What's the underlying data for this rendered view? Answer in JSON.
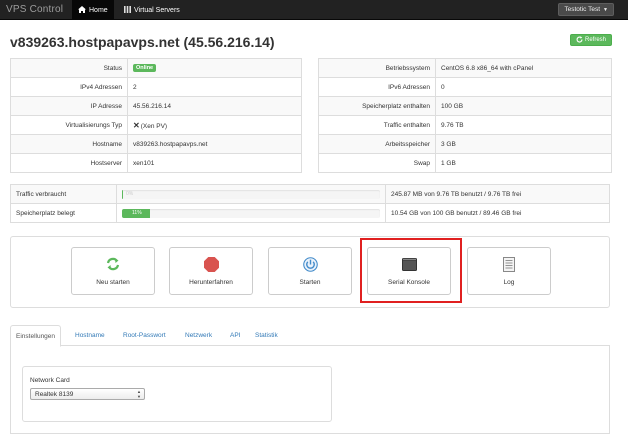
{
  "navbar": {
    "brand": "VPS Control",
    "home_label": "Home",
    "home_icon": "home-icon",
    "servers_label": "Virtual Servers",
    "servers_icon": "list-icon",
    "user_label": "Testotic Test"
  },
  "header": {
    "title": "v839263.hostpapavps.net (45.56.216.14)",
    "refresh_label": "Refresh",
    "refresh_icon": "refresh-icon"
  },
  "info_left": [
    {
      "label": "Status",
      "value": "Online"
    },
    {
      "label": "IPv4 Adressen",
      "value": "2"
    },
    {
      "label": "IP Adresse",
      "value": "45.56.216.14"
    },
    {
      "label": "Virtualisierungs Typ",
      "value": "(Xen PV)"
    },
    {
      "label": "Hostname",
      "value": "v839263.hostpapavps.net"
    },
    {
      "label": "Hostserver",
      "value": "xen101"
    }
  ],
  "info_right": [
    {
      "label": "Betriebssystem",
      "value": "CentOS 6.8 x86_64 with cPanel"
    },
    {
      "label": "IPv6 Adressen",
      "value": "0"
    },
    {
      "label": "Speicherplatz enthalten",
      "value": "100 GB"
    },
    {
      "label": "Traffic enthalten",
      "value": "9.76 TB"
    },
    {
      "label": "Arbeitsspeicher",
      "value": "3 GB"
    },
    {
      "label": "Swap",
      "value": "1 GB"
    }
  ],
  "usage": [
    {
      "label": "Traffic verbraucht",
      "percent_label": "0%",
      "percent": 0,
      "detail": "245.87 MB von 9.76 TB benutzt / 9.76 TB frei"
    },
    {
      "label": "Speicherplatz belegt",
      "percent_label": "11%",
      "percent": 11,
      "detail": "10.54 GB von 100 GB benutzt / 89.46 GB frei"
    }
  ],
  "actions": [
    {
      "label": "Neu starten",
      "icon": "restart-icon",
      "color": "#5cb85c"
    },
    {
      "label": "Herunterfahren",
      "icon": "stop-icon",
      "color": "#d9534f"
    },
    {
      "label": "Starten",
      "icon": "power-icon",
      "color": "#428bca"
    },
    {
      "label": "Serial Konsole",
      "icon": "terminal-icon",
      "color": "#333333"
    },
    {
      "label": "Log",
      "icon": "log-icon",
      "color": "#777777"
    }
  ],
  "tabs": [
    "Einstellungen",
    "Hostname",
    "Root-Passwort",
    "Netzwerk",
    "API",
    "Statistik"
  ],
  "settings": {
    "network_card_label": "Network Card",
    "network_card_value": "Realtek 8139"
  },
  "colors": {
    "navbar_bg": "#222222",
    "success": "#5cb85c",
    "link": "#337ab7",
    "highlight": "#e02020"
  }
}
